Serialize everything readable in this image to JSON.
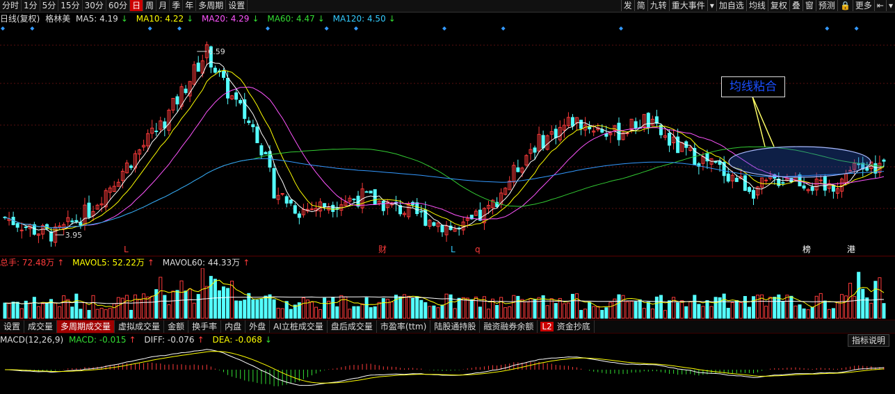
{
  "toolbar": {
    "periods": [
      "分时",
      "1分",
      "5分",
      "15分",
      "30分",
      "60分",
      "日",
      "周",
      "月",
      "季",
      "年",
      "多周期",
      "设置"
    ],
    "active_period": "日",
    "right_items": [
      "发",
      "简",
      "九转",
      "重大事件",
      "▾",
      "加自选",
      "均线",
      "复权",
      "叠",
      "窗",
      "预测",
      "🔒",
      "更多",
      "⇤",
      "▾"
    ]
  },
  "ma_row": {
    "chart_type": "日线(复权)",
    "stock_name": "格林美",
    "ma5": "MA5: 4.19",
    "ma5_arrow": "↓",
    "ma10": "MA10: 4.22",
    "ma10_arrow": "↓",
    "ma20": "MA20: 4.29",
    "ma20_arrow": "↓",
    "ma60": "MA60: 4.47",
    "ma60_arrow": "↓",
    "ma120": "MA120: 4.50",
    "ma120_arrow": "↓"
  },
  "price_panel": {
    "high_label": "6.59",
    "low_label": "3.95",
    "annotation": "均线粘合",
    "markers": [
      {
        "text": "L",
        "color": "#ff3b3b"
      },
      {
        "text": "财",
        "color": "#ff3b3b"
      },
      {
        "text": "L",
        "color": "#33ccff"
      },
      {
        "text": "q",
        "color": "#ff3b3b"
      },
      {
        "text": "榜",
        "color": "#ffffff"
      },
      {
        "text": "港",
        "color": "#ffffff"
      }
    ]
  },
  "volume_panel": {
    "total": "总手: 72.48万",
    "total_arrow": "↑",
    "mavol5": "MAVOL5: 52.22万",
    "mavol5_arrow": "↑",
    "mavol60": "MAVOL60: 44.33万",
    "mavol60_arrow": "↑"
  },
  "tabs": {
    "items": [
      "设置",
      "成交量",
      "多周期成交量",
      "虚拟成交量",
      "金额",
      "换手率",
      "内盘",
      "外盘",
      "AI立桩成交量",
      "盘后成交量",
      "市盈率(ttm)",
      "陆股通持股",
      "融资融券余额"
    ],
    "active": "多周期成交量",
    "l2_badge": "L2",
    "last_item": "资金抄底"
  },
  "macd_panel": {
    "title": "MACD(12,26,9)",
    "macd": "MACD: -0.015",
    "macd_arrow": "↑",
    "diff": "DIFF: -0.076",
    "diff_arrow": "↑",
    "dea": "DEA: -0.068",
    "dea_arrow": "↓",
    "indicator_button": "指标说明"
  },
  "colors": {
    "up": "#ff3b3b",
    "down": "#54ffff",
    "ma5": "#ffffff",
    "ma10": "#ffff00",
    "ma20": "#ff55ff",
    "ma60": "#33cc33",
    "ma120": "#3399ff"
  }
}
